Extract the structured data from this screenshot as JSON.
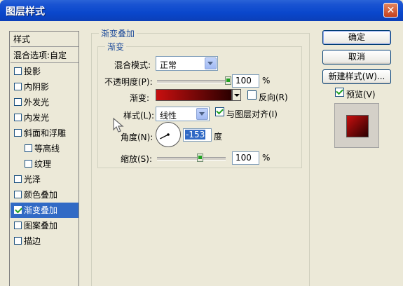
{
  "window": {
    "title": "图层样式",
    "close_symbol": "✕"
  },
  "style_list": {
    "header": "样式",
    "blend_options": "混合选项:自定",
    "items": [
      {
        "label": "投影",
        "checked": false
      },
      {
        "label": "内阴影",
        "checked": false
      },
      {
        "label": "外发光",
        "checked": false
      },
      {
        "label": "内发光",
        "checked": false
      },
      {
        "label": "斜面和浮雕",
        "checked": false
      },
      {
        "label": "等高线",
        "checked": false
      },
      {
        "label": "纹理",
        "checked": false
      },
      {
        "label": "光泽",
        "checked": false
      },
      {
        "label": "颜色叠加",
        "checked": false
      },
      {
        "label": "渐变叠加",
        "checked": true,
        "selected": true
      },
      {
        "label": "图案叠加",
        "checked": false
      },
      {
        "label": "描边",
        "checked": false
      }
    ]
  },
  "gradient_overlay": {
    "group_title": "渐变叠加",
    "sub_group_title": "渐变",
    "blend_mode_label": "混合模式:",
    "blend_mode_value": "正常",
    "opacity_label": "不透明度(P):",
    "opacity_value": "100",
    "opacity_level": 1.0,
    "percent": "%",
    "gradient_label": "渐变:",
    "gradient_colors": [
      "#c80f0f",
      "#2b0000"
    ],
    "reverse_label": "反向(R)",
    "reverse_checked": false,
    "style_label": "样式(L):",
    "style_value": "线性",
    "align_label": "与图层对齐(I)",
    "align_checked": true,
    "angle_label": "角度(N):",
    "angle_value": "-153",
    "degree": "度",
    "scale_label": "缩放(S):",
    "scale_value": "100",
    "scale_level": 0.5
  },
  "buttons": {
    "ok": "确定",
    "cancel": "取消",
    "new_style": "新建样式(W)...",
    "preview_label": "预览(V)",
    "preview_checked": true
  },
  "colors": {
    "titlebar": "#0a47cc",
    "selection": "#316ac5",
    "legend_text": "#1e4c9a",
    "check": "#21a121"
  }
}
